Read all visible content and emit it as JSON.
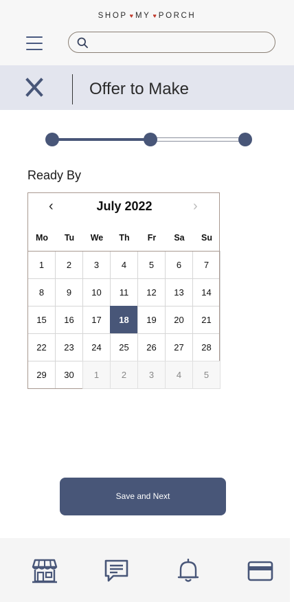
{
  "header": {
    "brand_parts": [
      "SHOP",
      "MY",
      "PORCH"
    ],
    "brand_separator": "♥",
    "search": {
      "value": "",
      "placeholder": ""
    }
  },
  "titlebar": {
    "title": "Offer to Make"
  },
  "progress": {
    "total_steps": 3,
    "current_step": 2
  },
  "form": {
    "label": "Ready By"
  },
  "calendar": {
    "month_label": "July 2022",
    "prev_symbol": "‹",
    "next_symbol": "›",
    "weekdays": [
      "Mo",
      "Tu",
      "We",
      "Th",
      "Fr",
      "Sa",
      "Su"
    ],
    "weeks": [
      [
        "1",
        "2",
        "3",
        "4",
        "5",
        "6",
        "7"
      ],
      [
        "8",
        "9",
        "10",
        "11",
        "12",
        "13",
        "14"
      ],
      [
        "15",
        "16",
        "17",
        "18",
        "19",
        "20",
        "21"
      ],
      [
        "22",
        "23",
        "24",
        "25",
        "26",
        "27",
        "28"
      ],
      [
        "29",
        "30",
        "1",
        "2",
        "3",
        "4",
        "5"
      ]
    ],
    "selected_day": "18",
    "next_month_days_shown": 5
  },
  "actions": {
    "save_label": "Save and Next"
  },
  "bottom_nav": {
    "items": [
      "storefront-icon",
      "messages-icon",
      "notifications-icon",
      "payment-card-icon"
    ]
  },
  "colors": {
    "accent": "#485678",
    "titlebar_bg": "#e3e5ee",
    "brand_heart": "#c0392b"
  }
}
